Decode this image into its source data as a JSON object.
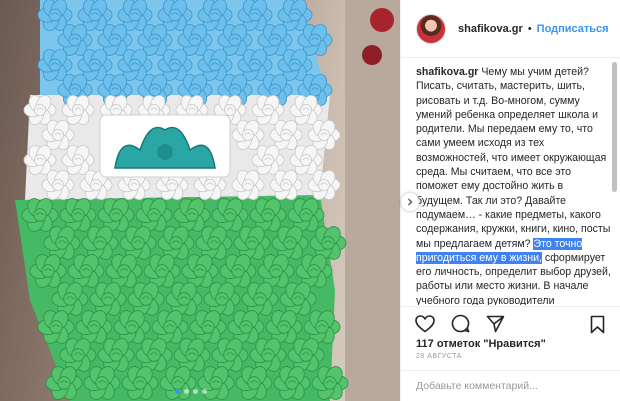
{
  "post": {
    "username": "shafikova.gr",
    "separator": "•",
    "follow_label": "Подписаться",
    "caption": {
      "author": "shafikova.gr",
      "text_before": "Чему мы учим детей? Писать, считать, мастерить, шить, рисовать и т.д. Во-многом, сумму умений ребенка определяет школа и родители. Мы передаем ему то, что сами умеем исходя из тех возможностей, что имеет окружающая среда. Мы считаем, что все это поможет ему достойно жить в будущем. Так ли это? Давайте подумаем… - какие предметы, какого содержания, кружки, книги, кино, посты мы предлагаем детям?",
      "highlight": "Это точно пригодиться ему в жизни,",
      "text_after": "сформирует его личность, определит выбор друзей, работы или место жизни. В начале учебного года руководители образовательных учреждений, учителя и родители будут выбирать образовательный маршрут детей. Вспомните о ребенке и тех умениях,"
    },
    "likes": {
      "count": "117",
      "text": "отметок \"Нравится\""
    },
    "date": "28 АВГУСТА",
    "comment_placeholder": "Добавьте комментарий...",
    "carousel": {
      "count": 4,
      "active": 0
    },
    "icons": [
      "heart-icon",
      "comment-icon",
      "share-icon",
      "bookmark-icon",
      "chevron-right-icon"
    ],
    "colors": {
      "follow": "#3897f0",
      "highlight": "#3f83f2",
      "flag_blue": "#62b8e6",
      "flag_white": "#f4f4f4",
      "flag_green": "#3fbf5c"
    }
  }
}
